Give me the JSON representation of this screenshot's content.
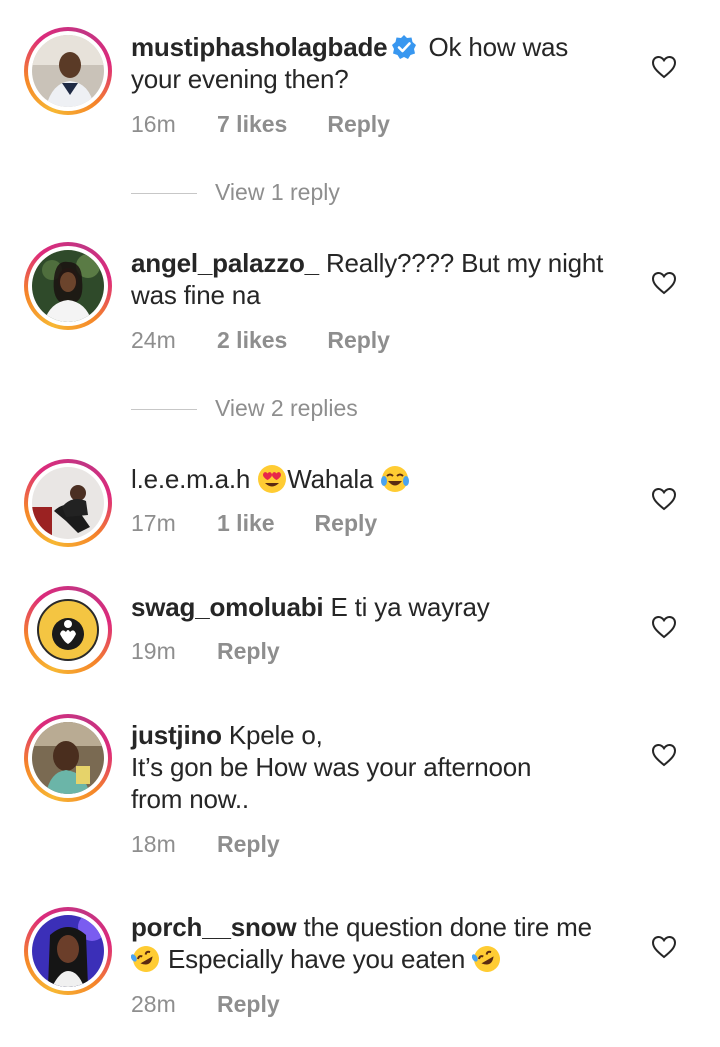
{
  "comments": [
    {
      "username": "mustiphasholagbade",
      "verified": true,
      "line1_after": "Ok how was",
      "line2": "your evening then?",
      "time": "16m",
      "likes": "7 likes",
      "reply": "Reply",
      "view_replies": "View 1 reply"
    },
    {
      "username": "angel_palazzo_",
      "line1_after": "Really???? But my night",
      "line2": "was fine na",
      "time": "24m",
      "likes": "2 likes",
      "reply": "Reply",
      "view_replies": "View 2 replies"
    },
    {
      "username": "l.e.e.m.a.h",
      "line1_after": "Wahala",
      "time": "17m",
      "likes": "1 like",
      "reply": "Reply"
    },
    {
      "username": "swag_omoluabi",
      "line1_after": "E ti ya wayray",
      "time": "19m",
      "reply": "Reply"
    },
    {
      "username": "justjino",
      "line1_after": "Kpele o,",
      "line2": "It’s gon be How was your afternoon",
      "line3": "from now..",
      "time": "18m",
      "reply": "Reply"
    },
    {
      "username": "porch__snow",
      "line1_after": "the question done tire me",
      "line2": "Especially have you eaten",
      "time": "28m",
      "reply": "Reply"
    }
  ],
  "icons": {
    "like": "heart-outline-icon",
    "verified": "verified-badge-icon",
    "emoji_heart_eyes": "heart-eyes-emoji",
    "emoji_tears_joy": "tears-of-joy-emoji",
    "emoji_rofl": "rolling-on-floor-laughing-emoji"
  },
  "colors": {
    "text": "#262626",
    "meta": "#8e8e8e",
    "verified": "#3897f0"
  }
}
